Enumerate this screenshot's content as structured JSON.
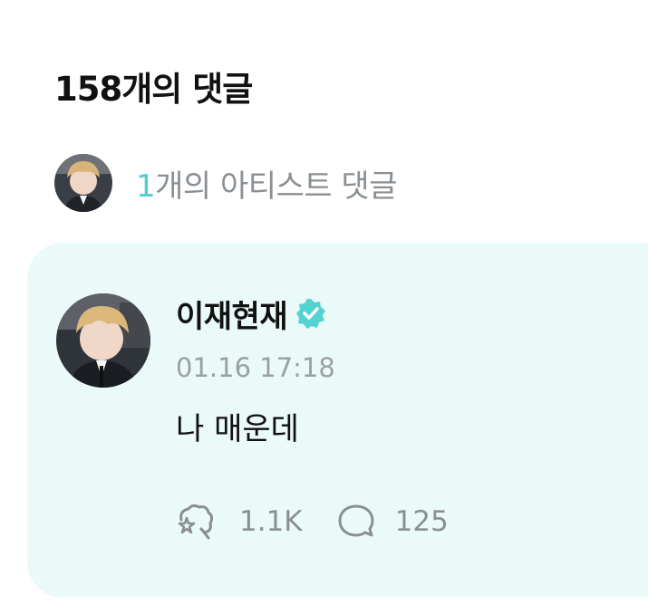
{
  "header": {
    "title": "158개의 댓글"
  },
  "artist_summary": {
    "count": "1",
    "label": "개의 아티스트 댓글"
  },
  "comment": {
    "author": "이재현재",
    "verified_icon": "verified-badge-icon",
    "timestamp": "01.16 17:18",
    "text": "나 매운데",
    "like_count": "1.1K",
    "reply_count": "125"
  },
  "colors": {
    "accent": "#4fd0cf",
    "card_background": "#eafaf8",
    "muted_text": "#8a8f93"
  }
}
